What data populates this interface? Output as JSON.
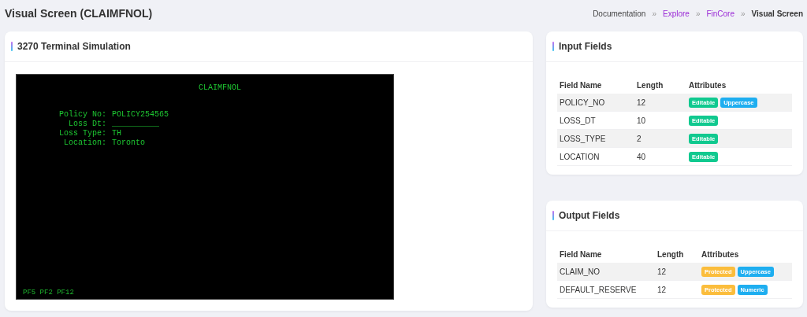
{
  "page_title": "Visual Screen (CLAIMFNOL)",
  "breadcrumb": [
    {
      "label": "Documentation",
      "kind": "text"
    },
    {
      "label": "»",
      "kind": "separator"
    },
    {
      "label": "Explore",
      "kind": "link"
    },
    {
      "label": "»",
      "kind": "separator"
    },
    {
      "label": "FinCore",
      "kind": "link"
    },
    {
      "label": "»",
      "kind": "separator"
    },
    {
      "label": "Visual Screen",
      "kind": "current"
    }
  ],
  "terminal": {
    "title": "3270 Terminal Simulation",
    "screen_name": "CLAIMFNOL",
    "fields": [
      {
        "label": "Policy No:",
        "value": "POLICY254565"
      },
      {
        "label": "Loss Dt:",
        "value": "__________"
      },
      {
        "label": "Loss Type:",
        "value": "TH"
      },
      {
        "label": "Location:",
        "value": "Toronto"
      }
    ],
    "function_keys": "PF5 PF2 PF12"
  },
  "input_fields": {
    "title": "Input Fields",
    "columns": [
      "Field Name",
      "Length",
      "Attributes"
    ],
    "rows": [
      {
        "name": "POLICY_NO",
        "length": "12",
        "attributes": [
          {
            "label": "Editable",
            "color": "#10c98f"
          },
          {
            "label": "Uppercase",
            "color": "#1eaef0"
          }
        ]
      },
      {
        "name": "LOSS_DT",
        "length": "10",
        "attributes": [
          {
            "label": "Editable",
            "color": "#10c98f"
          }
        ]
      },
      {
        "name": "LOSS_TYPE",
        "length": "2",
        "attributes": [
          {
            "label": "Editable",
            "color": "#10c98f"
          }
        ]
      },
      {
        "name": "LOCATION",
        "length": "40",
        "attributes": [
          {
            "label": "Editable",
            "color": "#10c98f"
          }
        ]
      }
    ]
  },
  "output_fields": {
    "title": "Output Fields",
    "columns": [
      "Field Name",
      "Length",
      "Attributes"
    ],
    "rows": [
      {
        "name": "CLAIM_NO",
        "length": "12",
        "attributes": [
          {
            "label": "Protected",
            "color": "#fbbd3c"
          },
          {
            "label": "Uppercase",
            "color": "#1eaef0"
          }
        ]
      },
      {
        "name": "DEFAULT_RESERVE",
        "length": "12",
        "attributes": [
          {
            "label": "Protected",
            "color": "#fbbd3c"
          },
          {
            "label": "Numeric",
            "color": "#1eaef0"
          }
        ]
      }
    ]
  }
}
